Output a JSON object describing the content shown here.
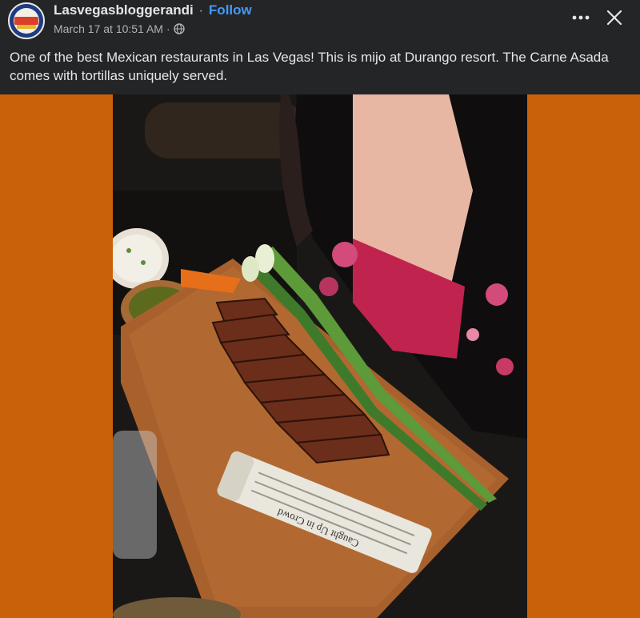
{
  "post": {
    "author": "Lasvegasbloggerandi",
    "separator": "·",
    "follow_label": "Follow",
    "timestamp": "March 17 at 10:51 AM",
    "meta_separator": "·",
    "privacy_icon": "globe-icon",
    "caption": "One of the best Mexican restaurants in Las Vegas! This is mijo at Durango resort. The Carne Asada comes with tortillas uniquely served."
  },
  "avatar": {
    "logo_text_top": "LAS VEGAS",
    "logo_text_bottom": "BLOGGER"
  },
  "controls": {
    "more_icon": "more-horizontal-icon",
    "close_icon": "close-icon"
  },
  "photo": {
    "newspaper_text": "Caught Up in Crowd"
  },
  "colors": {
    "header_bg": "#242526",
    "page_bg": "#c8620a",
    "link": "#4599ff",
    "text": "#e4e6eb",
    "muted": "#b0b3b8"
  }
}
